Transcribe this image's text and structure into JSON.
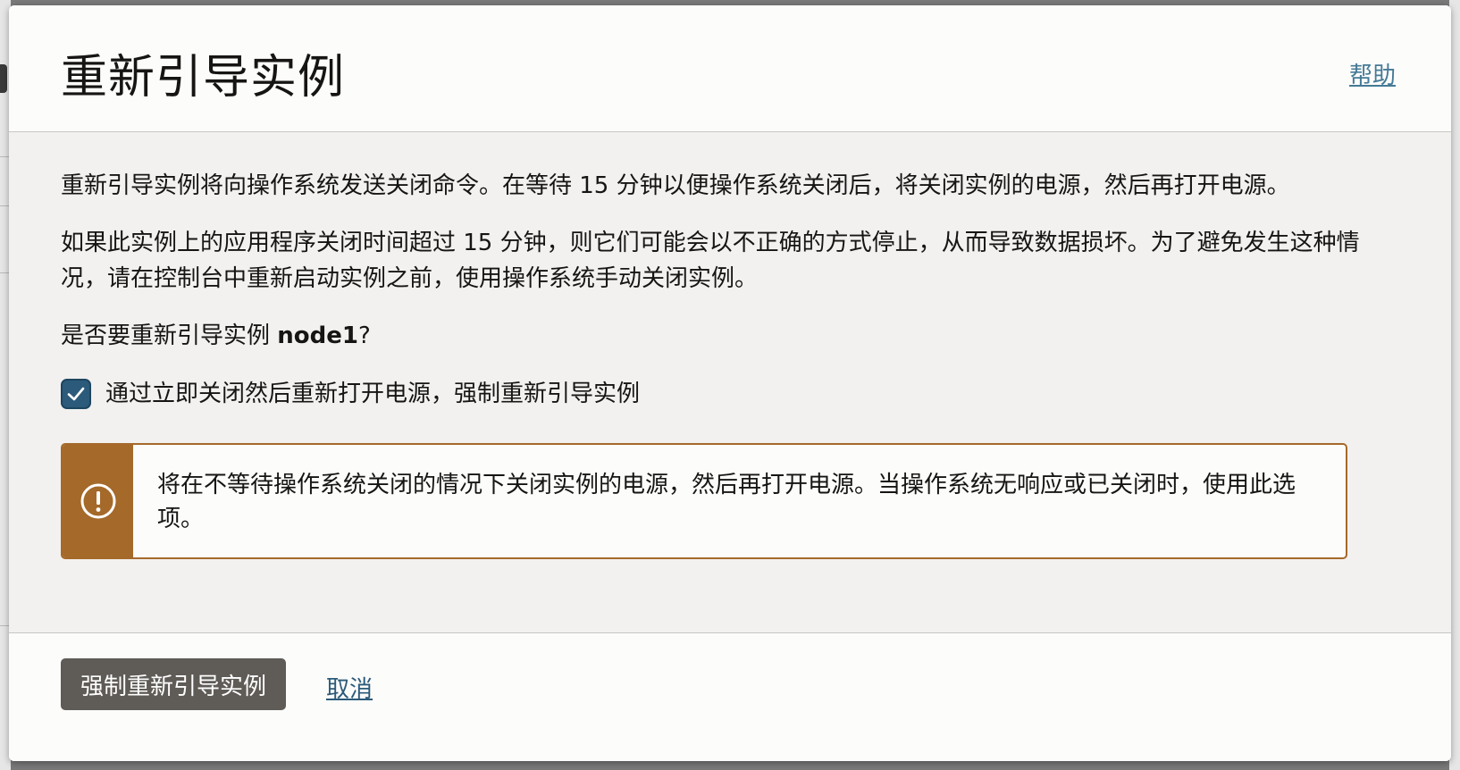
{
  "dialog": {
    "title": "重新引导实例",
    "help_label": "帮助"
  },
  "body": {
    "paragraph_1": "重新引导实例将向操作系统发送关闭命令。在等待 15 分钟以便操作系统关闭后，将关闭实例的电源，然后再打开电源。",
    "paragraph_2": "如果此实例上的应用程序关闭时间超过 15 分钟，则它们可能会以不正确的方式停止，从而导致数据损坏。为了避免发生这种情况，请在控制台中重新启动实例之前，使用操作系统手动关闭实例。",
    "question_prefix": "是否要重新引导实例 ",
    "instance_name": "node1",
    "question_suffix": "?",
    "force_checkbox": {
      "label": "通过立即关闭然后重新打开电源，强制重新引导实例",
      "checked": true
    },
    "warning": {
      "icon": "exclamation-circle-icon",
      "text": "将在不等待操作系统关闭的情况下关闭实例的电源，然后再打开电源。当操作系统无响应或已关闭时，使用此选项。"
    }
  },
  "footer": {
    "primary_label": "强制重新引导实例",
    "cancel_label": "取消"
  },
  "colors": {
    "checkbox": "#2c5a7a",
    "warning_accent": "#a5692a",
    "primary_button": "#5f5b57",
    "link": "#457a96"
  }
}
